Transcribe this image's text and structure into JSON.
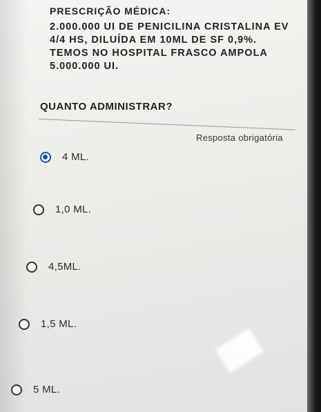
{
  "prescription": {
    "title": "PRESCRIÇÃO MÉDICA:",
    "lines": [
      "2.000.000 UI DE PENICILINA CRISTALINA EV",
      "4/4 HS, DILUÍDA EM 10ML DE SF 0,9%.",
      "TEMOS NO HOSPITAL FRASCO AMPOLA",
      "5.000.000 UI."
    ]
  },
  "question": {
    "text": "QUANTO ADMINISTRAR?",
    "required_label": "Resposta obrigatória"
  },
  "options": [
    {
      "label": "4 ML.",
      "selected": true
    },
    {
      "label": "1,0 ML.",
      "selected": false
    },
    {
      "label": "4,5ML.",
      "selected": false
    },
    {
      "label": "1,5 ML.",
      "selected": false
    },
    {
      "label": "5 ML.",
      "selected": false
    }
  ],
  "colors": {
    "radio_selected": "#1c4f9a",
    "text": "#222222"
  }
}
